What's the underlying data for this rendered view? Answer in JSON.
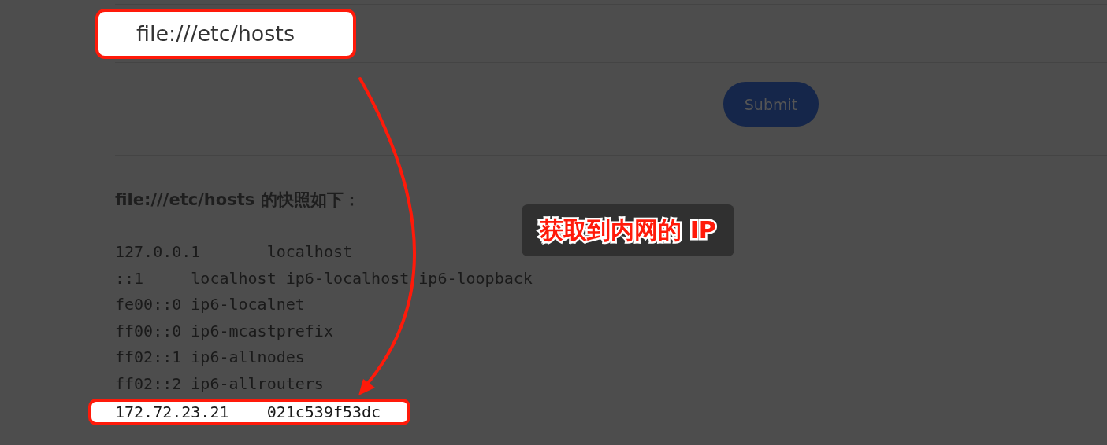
{
  "url_field": {
    "value": "file:///etc/hosts",
    "highlighted": true
  },
  "submit_button": {
    "label": "Submit"
  },
  "snapshot": {
    "heading": "file:///etc/hosts 的快照如下：",
    "lines": [
      {
        "text": "127.0.0.1       localhost",
        "highlighted": false
      },
      {
        "text": "::1     localhost ip6-localhost ip6-loopback",
        "highlighted": false
      },
      {
        "text": "fe00::0 ip6-localnet",
        "highlighted": false
      },
      {
        "text": "ff00::0 ip6-mcastprefix",
        "highlighted": false
      },
      {
        "text": "ff02::1 ip6-allnodes",
        "highlighted": false
      },
      {
        "text": "ff02::2 ip6-allrouters",
        "highlighted": false
      },
      {
        "text": "172.72.23.21    021c539f53dc",
        "highlighted": true
      }
    ]
  },
  "annotation": {
    "text": "获取到内网的 IP"
  }
}
